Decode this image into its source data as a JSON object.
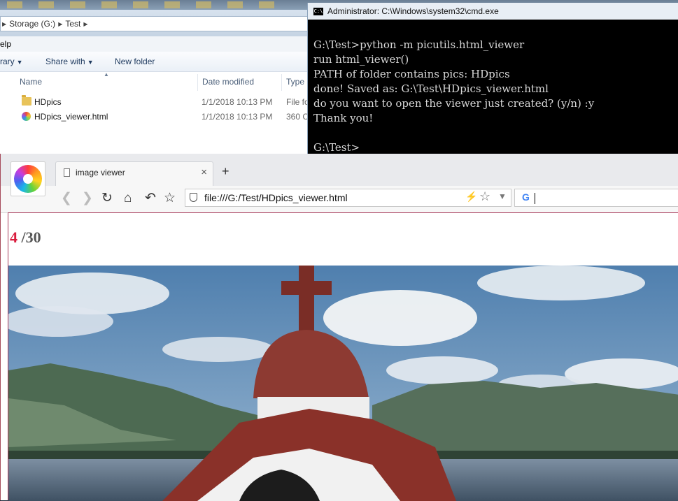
{
  "explorer": {
    "breadcrumb": [
      "Storage (G:)",
      "Test"
    ],
    "menu": {
      "help_label": "elp"
    },
    "toolbar": {
      "library_label": "rary",
      "share_label": "Share with",
      "new_folder_label": "New folder"
    },
    "columns": {
      "name": "Name",
      "date": "Date modified",
      "type": "Type"
    },
    "files": [
      {
        "name": "HDpics",
        "date": "1/1/2018 10:13 PM",
        "type": "File fo"
      },
      {
        "name": "HDpics_viewer.html",
        "date": "1/1/2018 10:13 PM",
        "type": "360 C"
      }
    ]
  },
  "console": {
    "title": "Administrator: C:\\Windows\\system32\\cmd.exe",
    "lines": [
      "G:\\Test>python -m picutils.html_viewer",
      "run html_viewer()",
      "PATH of folder contains pics: HDpics",
      "done! Saved as: G:\\Test\\HDpics_viewer.html",
      "do you want to open the viewer just created? (y/n) :y",
      "Thank you!",
      "",
      "G:\\Test>"
    ]
  },
  "browser": {
    "tab_title": "image viewer",
    "url": "file:///G:/Test/HDpics_viewer.html",
    "search_engine_icon": "G",
    "icons": {
      "back": "back-arrow-icon",
      "forward": "forward-arrow-icon",
      "reload": "reload-icon",
      "home": "home-icon",
      "undo": "undo-icon",
      "bookmark": "star-icon"
    }
  },
  "viewer": {
    "current": "4",
    "total": "/30"
  },
  "colors": {
    "counter_current": "#d91b3c",
    "console_bg": "#000000",
    "console_text": "#d8d8d8"
  }
}
